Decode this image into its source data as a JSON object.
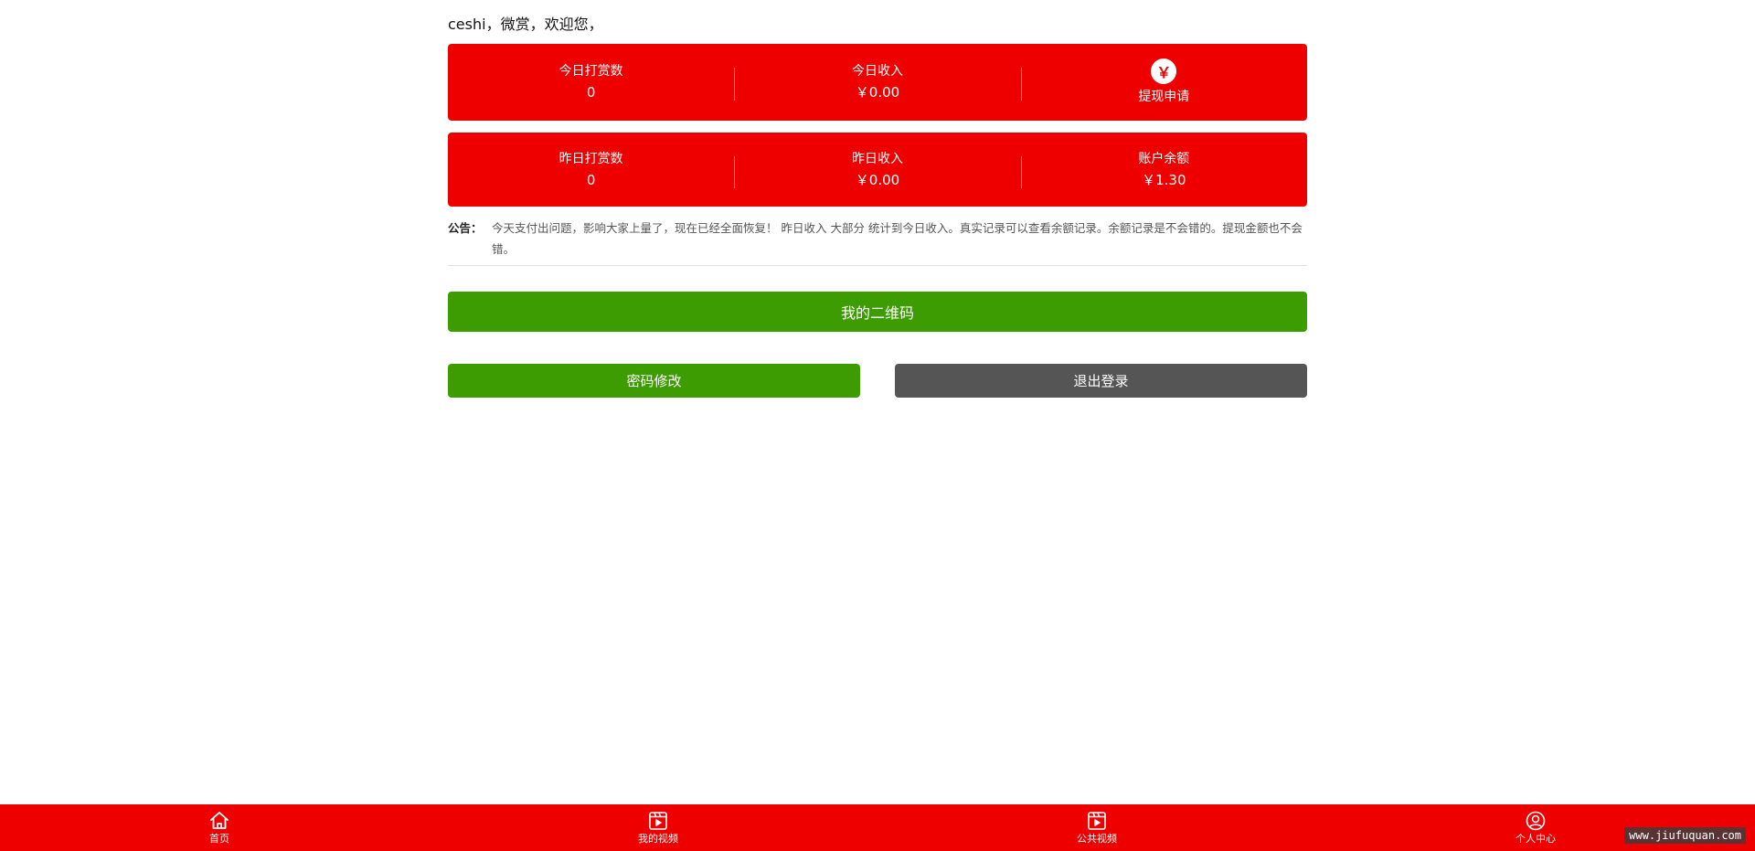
{
  "welcome": "ceshi，微赏，欢迎您，",
  "today": {
    "reward_count_label": "今日打赏数",
    "reward_count": "0",
    "income_label": "今日收入",
    "income": "￥0.00",
    "withdraw_icon": "￥",
    "withdraw_label": "提现申请"
  },
  "yesterday": {
    "reward_count_label": "昨日打赏数",
    "reward_count": "0",
    "income_label": "昨日收入",
    "income": "￥0.00",
    "balance_label": "账户余额",
    "balance": "￥1.30"
  },
  "notice": {
    "label": "公告：",
    "text": "今天支付出问题，影响大家上量了，现在已经全面恢复！ 昨日收入  大部分 统计到今日收入。真实记录可以查看余额记录。余额记录是不会错的。提现金额也不会错。"
  },
  "buttons": {
    "qrcode": "我的二维码",
    "change_password": "密码修改",
    "logout": "退出登录"
  },
  "nav": {
    "home": "首页",
    "my_videos": "我的视频",
    "public_videos": "公共视频",
    "profile": "个人中心"
  },
  "watermark": "www.jiufuquan.com",
  "colors": {
    "primary_red": "#ee0000",
    "green": "#3e9c03",
    "gray": "#555555"
  }
}
